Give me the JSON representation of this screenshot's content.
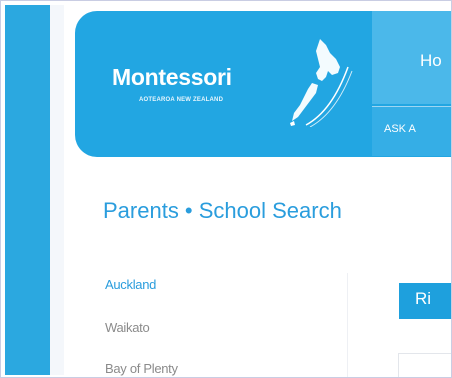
{
  "header": {
    "logo": {
      "wordmark": "Montessori",
      "tagline": "AOTEAROA NEW ZEALAND"
    },
    "nav": {
      "home_label": "Ho",
      "ask_label": "ASK A"
    }
  },
  "main": {
    "page_title": "Parents • School Search",
    "regions": [
      {
        "label": "Auckland",
        "active": true
      },
      {
        "label": "Waikato",
        "active": false
      },
      {
        "label": "Bay of Plenty",
        "active": false
      }
    ],
    "tab_label": "Ri"
  },
  "colors": {
    "brand_blue": "#22a6e2",
    "title_blue": "#2a9ddd",
    "muted_gray": "#8b8b8b"
  },
  "icons": {
    "map": "new-zealand-map-icon"
  }
}
